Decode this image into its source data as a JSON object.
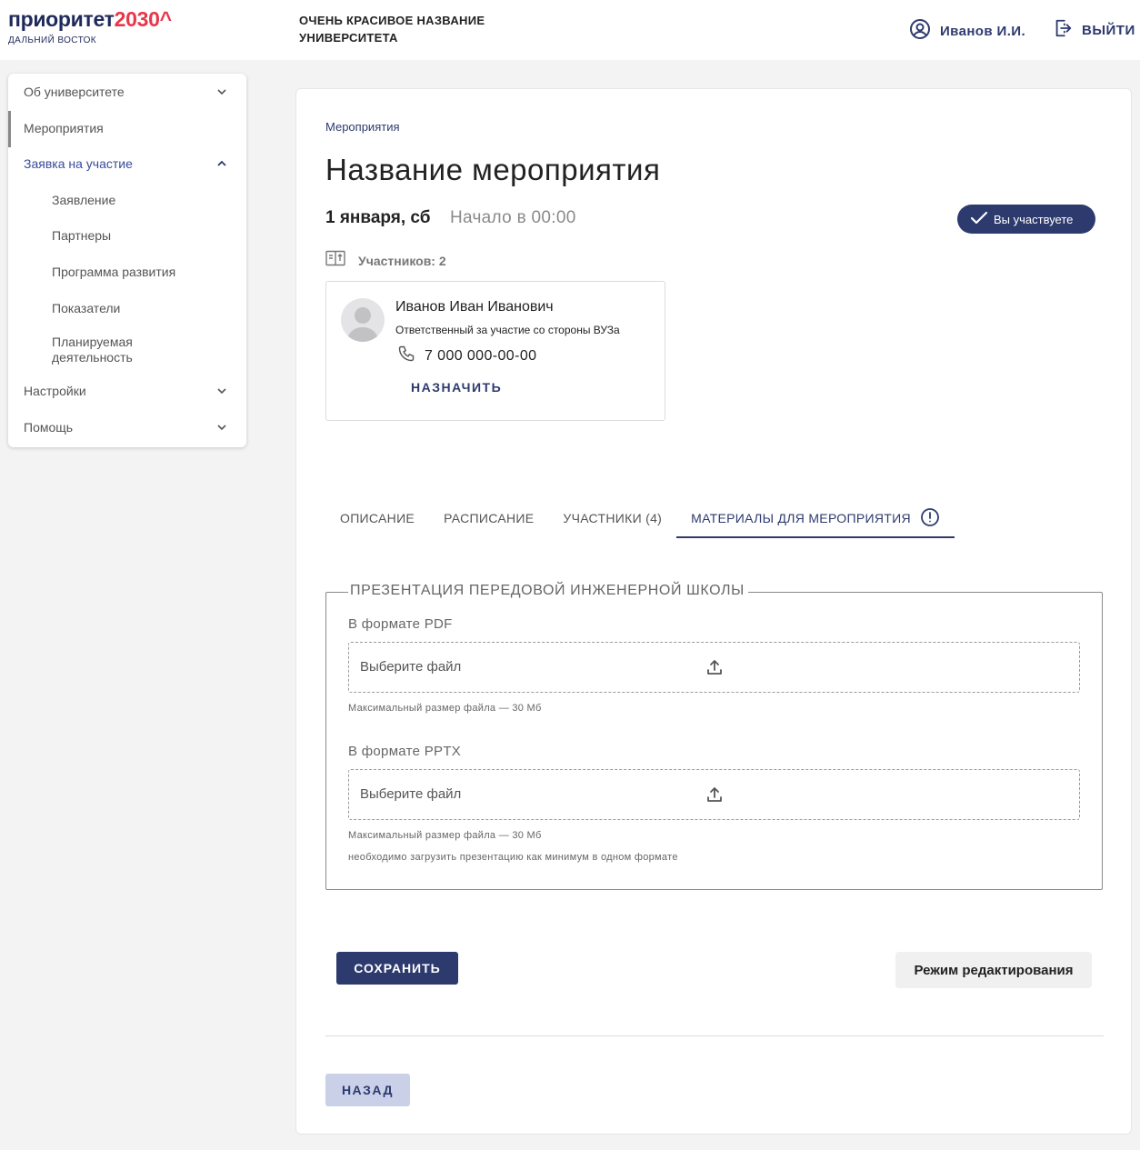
{
  "header": {
    "logo_main": "приоритет",
    "logo_accent": "2030^",
    "logo_sub": "ДАЛЬНИЙ ВОСТОК",
    "university_line1": "ОЧЕНЬ КРАСИВОЕ НАЗВАНИЕ",
    "university_line2": "УНИВЕРСИТЕТА",
    "user_name": "Иванов И.И.",
    "logout_label": "ВЫЙТИ"
  },
  "sidebar": {
    "items": [
      {
        "label": "Об университете",
        "icon": "chevron-down-icon"
      },
      {
        "label": "Мероприятия"
      },
      {
        "label": "Заявка на участие",
        "icon": "chevron-up-icon"
      },
      {
        "label": "Заявление"
      },
      {
        "label": "Партнеры"
      },
      {
        "label": "Программа развития"
      },
      {
        "label": "Показатели"
      },
      {
        "label": "Планируемая деятельность"
      },
      {
        "label": "Настройки",
        "icon": "chevron-down-icon"
      },
      {
        "label": "Помощь",
        "icon": "chevron-down-icon"
      }
    ]
  },
  "event": {
    "breadcrumb": "Мероприятия",
    "title": "Название мероприятия",
    "date": "1 января, сб",
    "start": "Начало в 00:00",
    "status_badge": "Вы участвуете",
    "participants": "Участников: 2"
  },
  "person": {
    "name": "Иванов Иван Иванович",
    "role": "Ответственный за участие со стороны ВУЗа",
    "phone": "7 000 000-00-00",
    "assign_label": "НАЗНАЧИТЬ"
  },
  "tabs": [
    {
      "label": "ОПИСАНИЕ"
    },
    {
      "label": "РАСПИСАНИЕ"
    },
    {
      "label": "УЧАСТНИКИ (4)"
    },
    {
      "label": "МАТЕРИАЛЫ ДЛЯ МЕРОПРИЯТИЯ",
      "active": true,
      "icon": "alert-circle-icon"
    }
  ],
  "materials": {
    "legend": "ПРЕЗЕНТАЦИЯ ПЕРЕДОВОЙ ИНЖЕНЕРНОЙ ШКОЛЫ",
    "pdf_label": "В формате PDF",
    "pdf_placeholder": "Выберите файл",
    "pdf_hint": "Максимальный размер файла — 30 Мб",
    "pptx_label": "В формате PPTX",
    "pptx_placeholder": "Выберите файл",
    "pptx_hint": "Максимальный размер файла — 30 Мб",
    "note": "необходимо загрузить презентацию как минимум в одном формате"
  },
  "actions": {
    "save": "СОХРАНИТЬ",
    "edit_mode": "Режим редактирования",
    "back": "НАЗАД"
  },
  "colors": {
    "primary": "#2d3a6e",
    "accent_red": "#e8364a",
    "back_button": "#c9d0e8"
  }
}
